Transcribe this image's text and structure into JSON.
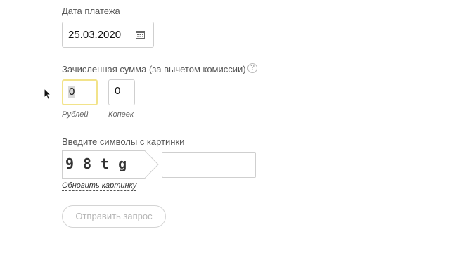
{
  "payment_date": {
    "label": "Дата платежа",
    "value": "25.03.2020",
    "icon": "calendar-icon"
  },
  "amount": {
    "label": "Зачисленная сумма (за вычетом комиссии)",
    "help_icon": "?",
    "rubles_value": "0",
    "rubles_label": "Рублей",
    "kopecks_value": "0",
    "kopecks_label": "Копеек"
  },
  "captcha": {
    "label": "Введите символы с картинки",
    "image_text": "98tg",
    "input_value": "",
    "refresh_label": "Обновить картинку"
  },
  "submit": {
    "label": "Отправить запрос"
  },
  "colors": {
    "focus_border": "#f2e38a",
    "border": "#cfcfcf",
    "disabled_text": "#b5b5b5"
  }
}
